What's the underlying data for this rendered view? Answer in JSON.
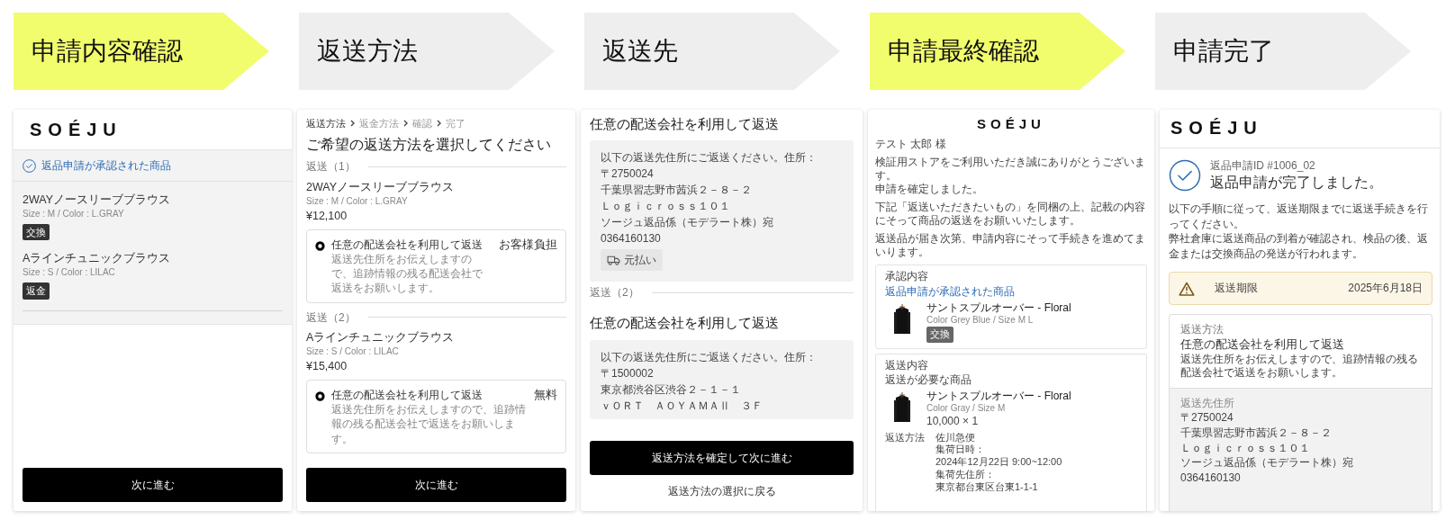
{
  "steps": [
    {
      "label": "申請内容確認",
      "highlighted": true
    },
    {
      "label": "返送方法",
      "highlighted": false
    },
    {
      "label": "返送先",
      "highlighted": false
    },
    {
      "label": "申請最終確認",
      "highlighted": true
    },
    {
      "label": "申請完了",
      "highlighted": false
    }
  ],
  "screens": [
    {
      "kind": "approved_items",
      "logo": "SOÉJU",
      "notice": "返品申請が承認された商品",
      "items": [
        {
          "name": "2WAYノースリーブブラウス",
          "variant": "Size : M / Color : L.GRAY",
          "tag": "交換"
        },
        {
          "name": "Aラインチュニックブラウス",
          "variant": "Size : S / Color : LILAC",
          "tag": "返金"
        }
      ],
      "button": "次に進む"
    },
    {
      "kind": "return_method",
      "breadcrumb": [
        {
          "label": "返送方法",
          "selected": true
        },
        {
          "label": "返金方法",
          "selected": false
        },
        {
          "label": "確認",
          "selected": false
        },
        {
          "label": "完了",
          "selected": false
        }
      ],
      "heading": "ご希望の返送方法を選択してください",
      "shipments": [
        {
          "label": "返送（1）",
          "name": "2WAYノースリーブブラウス",
          "variant": "Size : M / Color : L.GRAY",
          "price": "¥12,100",
          "option": {
            "title": "任意の配送会社を利用して返送",
            "description": "返送先住所をお伝えしますので、追跡情報の残る配送会社で返送をお願いします。",
            "fee": "お客様負担",
            "selected": true
          }
        },
        {
          "label": "返送（2）",
          "name": "Aラインチュニックブラウス",
          "variant": "Size : S / Color : LILAC",
          "price": "¥15,400",
          "option": {
            "title": "任意の配送会社を利用して返送",
            "description": "返送先住所をお伝えしますので、追跡情報の残る配送会社で返送をお願いします。",
            "fee": "無料",
            "selected": true
          }
        }
      ],
      "button": "次に進む"
    },
    {
      "kind": "return_address",
      "shipments": [
        {
          "title": "任意の配送会社を利用して返送",
          "address": [
            "以下の返送先住所にご返送ください。住所：",
            "〒2750024",
            "千葉県習志野市茜浜２－８－２",
            "Ｌｏｇｉｃｒｏｓｓ１０１",
            "ソージュ返品係（モデラート株）宛",
            "0364160130"
          ],
          "payment": "元払い"
        },
        {
          "label": "返送（2）",
          "title": "任意の配送会社を利用して返送",
          "address": [
            "以下の返送先住所にご返送ください。住所：",
            "〒1500002",
            "東京都渋谷区渋谷２－１－１",
            "ｖＯＲＴ　ＡＯＹＡＭＡⅡ　３Ｆ"
          ]
        }
      ],
      "button": "返送方法を確定して次に進む",
      "link": "返送方法の選択に戻る"
    },
    {
      "kind": "final_confirmation",
      "logo": "SOÉJU",
      "greeting": "テスト 太郎 様",
      "paragraphs": [
        [
          "検証用ストアをご利用いただき誠にありがとうございます。",
          "申請を確定しました。"
        ],
        [
          "下記「返送いただきたいもの」を同梱の上、記載の内容にそって商品の返送をお願いいたします。"
        ],
        [
          "返送品が届き次第、申請内容にそって手続きを進めてまいります。"
        ]
      ],
      "approval": {
        "title": "承認内容",
        "subtitle": "返品申請が承認された商品",
        "products": [
          {
            "name": "サントスプルオーバー - Floral",
            "variant": "Color Grey Blue / Size M L",
            "tag": "交換"
          }
        ]
      },
      "return": {
        "title": "返送内容",
        "subtitle": "返送が必要な商品",
        "products": [
          {
            "name": "サントスプルオーバー - Floral",
            "variant": "Color Gray / Size M",
            "quantity": "10,000 × 1"
          }
        ],
        "method_label": "返送方法",
        "method_lines": [
          "佐川急便",
          "集荷日時：",
          "2024年12月22日 9:00~12:00",
          "集荷先住所：",
          "東京都台東区台東1-1-1"
        ]
      }
    },
    {
      "kind": "complete",
      "logo": "SOÉJU",
      "request_id": "返品申請ID #1006_02",
      "message": "返品申請が完了しました。",
      "instructions": [
        "以下の手順に従って、返送期限までに返送手続きを行ってください。",
        "弊社倉庫に返送商品の到着が確認され、検品の後、返金または交換商品の発送が行われます。"
      ],
      "deadline": {
        "label": "返送期限",
        "date": "2025年6月18日"
      },
      "method": {
        "label": "返送方法",
        "title": "任意の配送会社を利用して返送",
        "description": "返送先住所をお伝えしますので、追跡情報の残る配送会社で返送をお願いします。"
      },
      "address": {
        "label": "返送先住所",
        "lines": [
          "〒2750024",
          "千葉県習志野市茜浜２－８－２",
          "Ｌｏｇｉｃｒｏｓｓ１０１",
          "ソージュ返品係（モデラート株）宛",
          "0364160130"
        ]
      }
    }
  ]
}
